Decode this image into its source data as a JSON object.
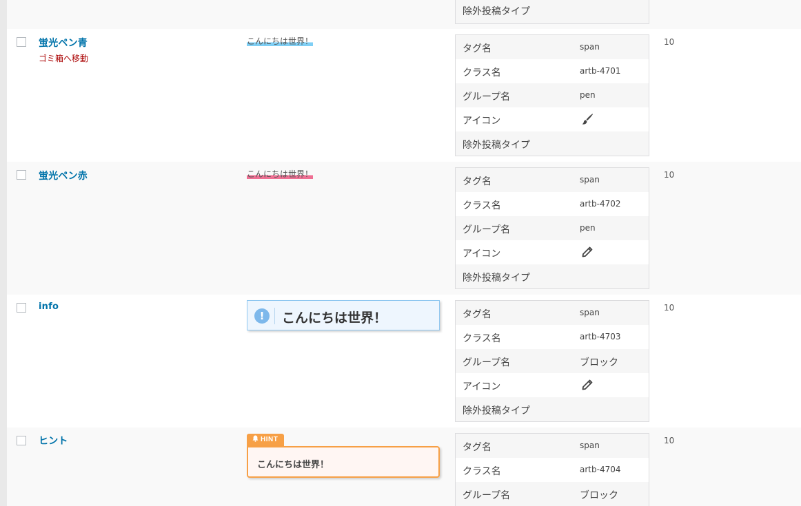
{
  "columns": {
    "prop_labels": {
      "tag": "タグ名",
      "class": "クラス名",
      "group": "グループ名",
      "icon": "アイコン",
      "exclude": "除外投稿タイプ"
    }
  },
  "rows": [
    {
      "title": "",
      "preview_text": "",
      "count": "",
      "props": {
        "tag": "",
        "class": "",
        "group": "",
        "icon": "",
        "exclude": ""
      }
    },
    {
      "title": "蛍光ペン青",
      "trash_label": "ゴミ箱へ移動",
      "preview_text": "こんにちは世界！",
      "count": "10",
      "props": {
        "tag": "span",
        "class": "artb-4701",
        "group": "pen",
        "icon": "paintbrush-icon",
        "exclude": ""
      }
    },
    {
      "title": "蛍光ペン赤",
      "preview_text": "こんにちは世界！",
      "count": "10",
      "props": {
        "tag": "span",
        "class": "artb-4702",
        "group": "pen",
        "icon": "pencil-icon",
        "exclude": ""
      }
    },
    {
      "title": "info",
      "preview_text": "こんにちは世界！",
      "preview_icon": "!",
      "count": "10",
      "props": {
        "tag": "span",
        "class": "artb-4703",
        "group": "ブロック",
        "icon": "pencil-icon",
        "exclude": ""
      }
    },
    {
      "title": "ヒント",
      "preview_text": "こんにちは世界！",
      "preview_badge": "HINT",
      "count": "10",
      "props": {
        "tag": "span",
        "class": "artb-4704",
        "group": "ブロック"
      }
    }
  ],
  "colors": {
    "link": "#0073aa",
    "trash": "#aa0000",
    "pen_blue": "#7fcff5",
    "pen_red": "#ef6f93",
    "info_border": "#8fc7f0",
    "hint_orange": "#f7a046"
  }
}
